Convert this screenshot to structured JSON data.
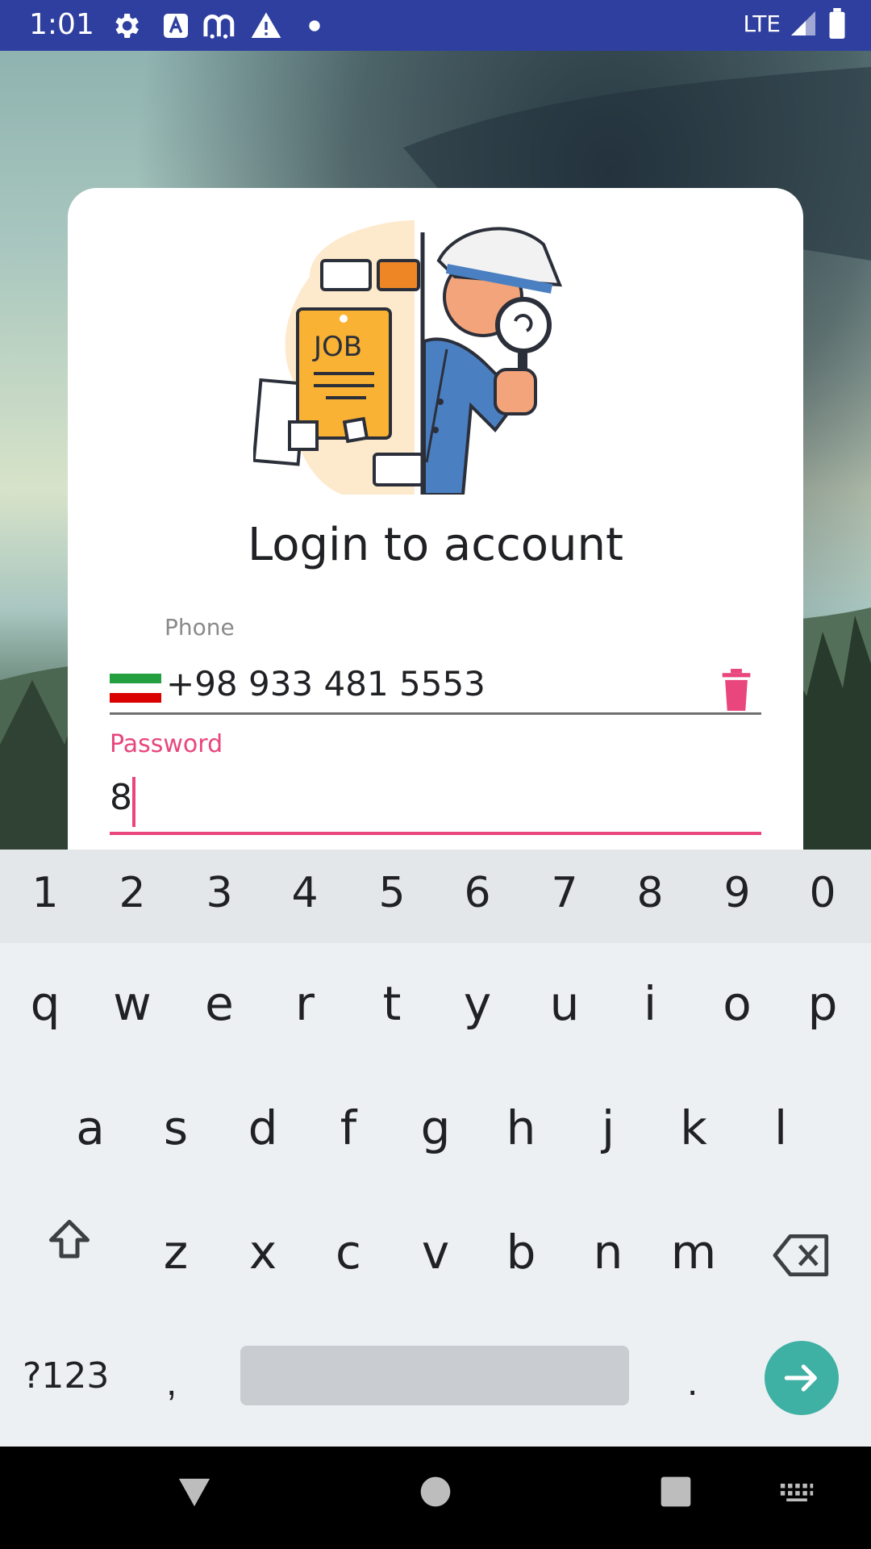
{
  "status_bar": {
    "time": "1:01",
    "network": "LTE",
    "icons": [
      "settings-icon",
      "a-accessibility-icon",
      "m-app-icon",
      "warning-icon",
      "dot-icon",
      "signal-icon",
      "battery-icon"
    ]
  },
  "login": {
    "title": "Login to account",
    "phone_label": "Phone",
    "phone_value": "+98 933 481 5553",
    "password_label": "Password",
    "password_value": "8",
    "accent_color": "#e8467c"
  },
  "illustration": {
    "job_label": "JOB"
  },
  "keyboard": {
    "numbers": [
      "1",
      "2",
      "3",
      "4",
      "5",
      "6",
      "7",
      "8",
      "9",
      "0"
    ],
    "row1": [
      "q",
      "w",
      "e",
      "r",
      "t",
      "y",
      "u",
      "i",
      "o",
      "p"
    ],
    "row2": [
      "a",
      "s",
      "d",
      "f",
      "g",
      "h",
      "j",
      "k",
      "l"
    ],
    "row3": [
      "z",
      "x",
      "c",
      "v",
      "b",
      "n",
      "m"
    ],
    "symbols_label": "?123",
    "comma": ",",
    "period": ".",
    "enter_color": "#3fb0a4"
  },
  "nav_bar": {
    "icons": [
      "back-icon",
      "home-icon",
      "recents-icon",
      "keyboard-icon"
    ]
  }
}
